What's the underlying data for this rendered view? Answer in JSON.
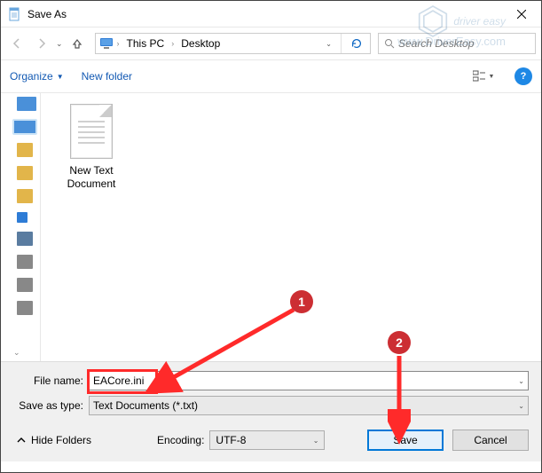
{
  "window": {
    "title": "Save As"
  },
  "nav": {
    "crumbs": [
      "This PC",
      "Desktop"
    ],
    "search_placeholder": "Search Desktop"
  },
  "toolbar": {
    "organize": "Organize",
    "new_folder": "New folder"
  },
  "files": [
    {
      "name": "New Text Document"
    }
  ],
  "form": {
    "filename_label": "File name:",
    "filename_value": "EACore.ini",
    "savetype_label": "Save as type:",
    "savetype_value": "Text Documents (*.txt)",
    "encoding_label": "Encoding:",
    "encoding_value": "UTF-8",
    "hide_folders": "Hide Folders",
    "save": "Save",
    "cancel": "Cancel"
  },
  "callouts": {
    "one": "1",
    "two": "2"
  },
  "watermark": {
    "brand": "driver easy",
    "url": "www.DriverEasy.com"
  }
}
